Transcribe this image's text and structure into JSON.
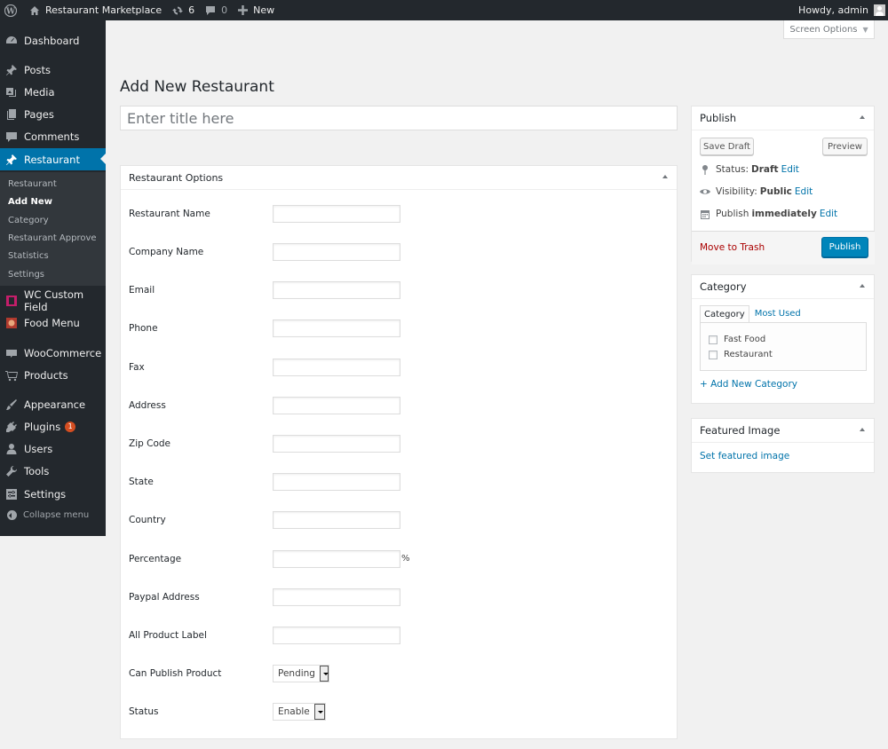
{
  "adminbar": {
    "site_name": "Restaurant Marketplace",
    "updates_count": "6",
    "comments_count": "0",
    "new_label": "New",
    "howdy": "Howdy, admin"
  },
  "sidebar": {
    "items": [
      {
        "label": "Dashboard",
        "icon": "dashboard-icon"
      },
      {
        "label": "Posts",
        "icon": "pin-icon"
      },
      {
        "label": "Media",
        "icon": "media-icon"
      },
      {
        "label": "Pages",
        "icon": "pages-icon"
      },
      {
        "label": "Comments",
        "icon": "comment-icon"
      },
      {
        "label": "Restaurant",
        "icon": "pin-icon"
      },
      {
        "label": "WC Custom Field",
        "icon": "custom-field-icon"
      },
      {
        "label": "Food Menu",
        "icon": "food-menu-icon"
      },
      {
        "label": "WooCommerce",
        "icon": "woocommerce-icon"
      },
      {
        "label": "Products",
        "icon": "cart-icon"
      },
      {
        "label": "Appearance",
        "icon": "brush-icon"
      },
      {
        "label": "Plugins",
        "icon": "plugin-icon",
        "badge": "1"
      },
      {
        "label": "Users",
        "icon": "user-icon"
      },
      {
        "label": "Tools",
        "icon": "wrench-icon"
      },
      {
        "label": "Settings",
        "icon": "settings-icon"
      }
    ],
    "submenu": [
      "Restaurant",
      "Add New",
      "Category",
      "Restaurant Approve",
      "Statistics",
      "Settings"
    ],
    "collapse": "Collapse menu"
  },
  "screen_options": "Screen Options",
  "page_title": "Add New Restaurant",
  "title_placeholder": "Enter title here",
  "restaurant_options": {
    "heading": "Restaurant Options",
    "fields": [
      {
        "label": "Restaurant Name",
        "value": ""
      },
      {
        "label": "Company Name",
        "value": ""
      },
      {
        "label": "Email",
        "value": ""
      },
      {
        "label": "Phone",
        "value": ""
      },
      {
        "label": "Fax",
        "value": ""
      },
      {
        "label": "Address",
        "value": ""
      },
      {
        "label": "Zip Code",
        "value": ""
      },
      {
        "label": "State",
        "value": ""
      },
      {
        "label": "Country",
        "value": ""
      },
      {
        "label": "Percentage",
        "value": "",
        "suffix": "%"
      },
      {
        "label": "Paypal Address",
        "value": ""
      },
      {
        "label": "All Product Label",
        "value": ""
      },
      {
        "label": "Can Publish Product",
        "select": "Pending"
      },
      {
        "label": "Status",
        "select": "Enable"
      }
    ]
  },
  "publish": {
    "heading": "Publish",
    "save_draft": "Save Draft",
    "preview": "Preview",
    "status_label": "Status:",
    "status_value": "Draft",
    "visibility_label": "Visibility:",
    "visibility_value": "Public",
    "publish_label": "Publish",
    "publish_value": "immediately",
    "edit": "Edit",
    "trash": "Move to Trash",
    "publish_button": "Publish"
  },
  "category": {
    "heading": "Category",
    "tab_all": "Category",
    "tab_popular": "Most Used",
    "items": [
      "Fast Food",
      "Restaurant"
    ],
    "add_new": "+ Add New Category"
  },
  "featured_image": {
    "heading": "Featured Image",
    "link": "Set featured image"
  },
  "colors": {
    "admin_bar": "#23282d",
    "accent": "#0073aa",
    "primary_button": "#0085ba",
    "trash": "#aa0000",
    "badge": "#d54e21"
  }
}
